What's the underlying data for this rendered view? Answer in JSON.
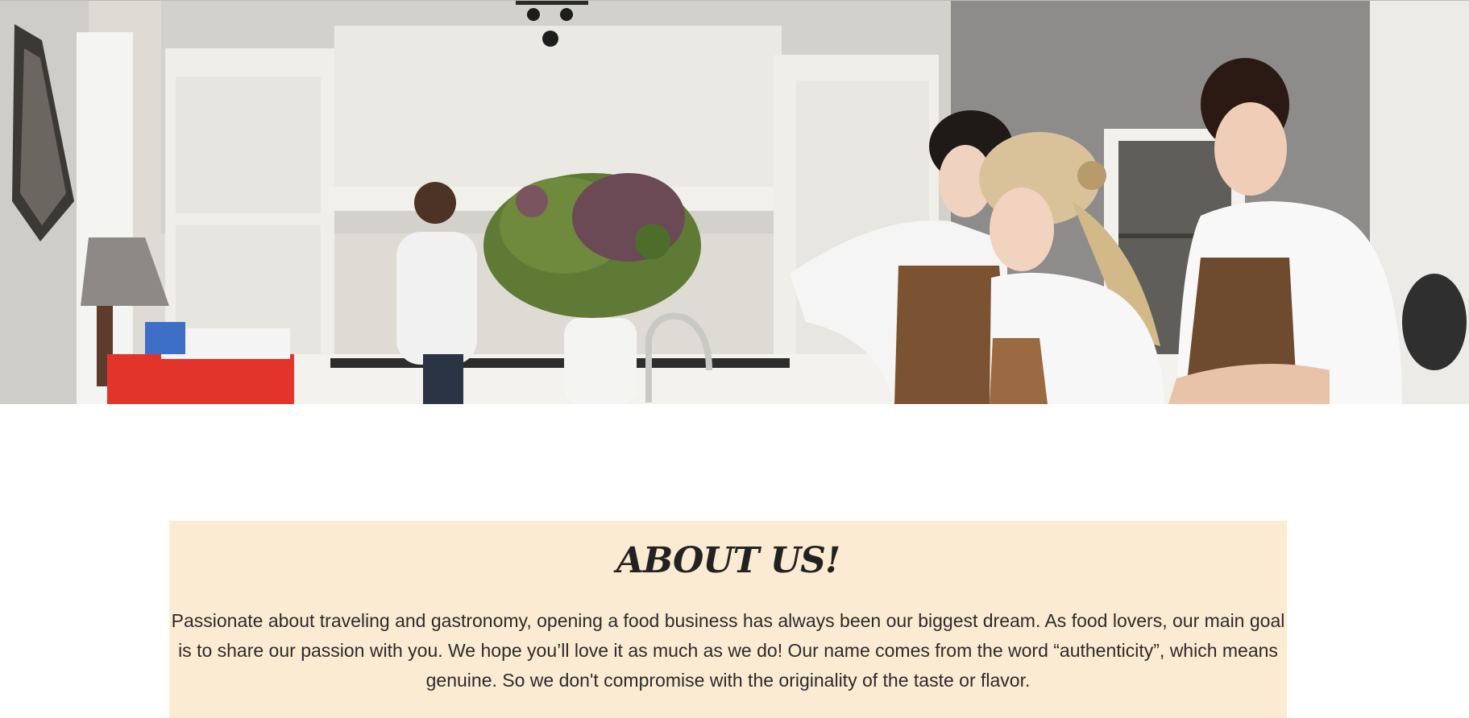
{
  "hero": {
    "image_description_icon": "kitchen-photo"
  },
  "about": {
    "title": "ABOUT US!",
    "body": "Passionate about traveling and gastronomy, opening a food business has always been our biggest dream. As food lovers, our main goal is to share our passion with you. We hope you’ll love it as much as we do! Our name comes from the word “authenticity”, which means genuine. So we don't compromise with the originality of the taste or flavor."
  },
  "colors": {
    "about_background": "#fcebd3",
    "title_color": "#222222",
    "text_color": "#2b2b2b"
  }
}
